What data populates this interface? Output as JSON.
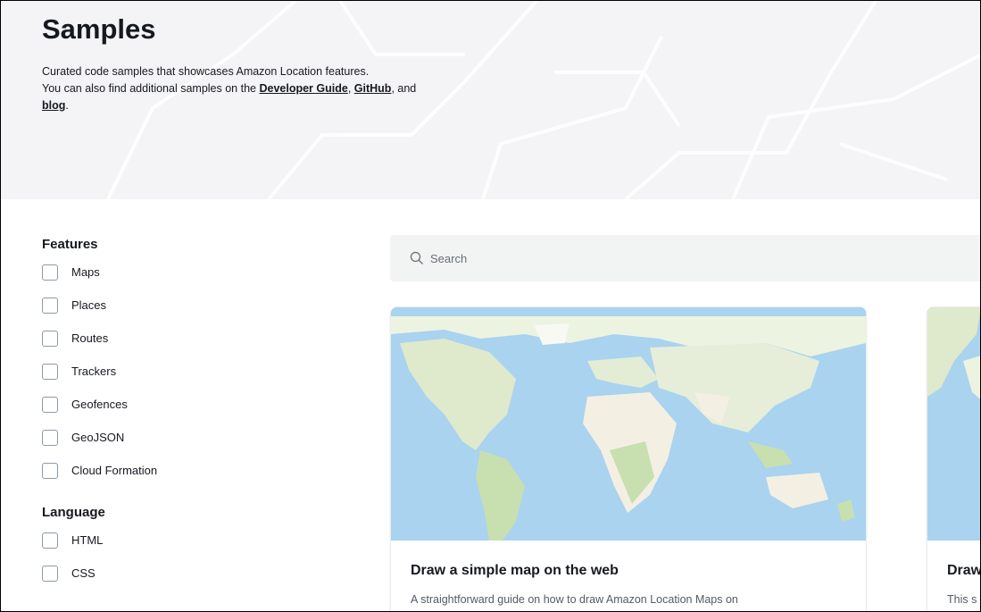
{
  "page": {
    "title": "Samples",
    "description_line1": "Curated code samples that showcases Amazon Location features.",
    "description_line2_prefix": "You can also find additional samples on the",
    "link_developer_guide": "Developer Guide",
    "sep1": ",",
    "link_github": "GitHub",
    "sep2": ", and",
    "link_blog": "blog",
    "end": "."
  },
  "filters": {
    "features_heading": "Features",
    "features": [
      "Maps",
      "Places",
      "Routes",
      "Trackers",
      "Geofences",
      "GeoJSON",
      "Cloud Formation"
    ],
    "language_heading": "Language",
    "languages": [
      "HTML",
      "CSS"
    ]
  },
  "search": {
    "placeholder": "Search",
    "icon": "search-icon"
  },
  "cards": [
    {
      "title": "Draw a simple map on the web",
      "text": "A straightforward guide on how to draw Amazon Location Maps on"
    },
    {
      "title": "Draw",
      "text": "This s"
    }
  ],
  "colors": {
    "ocean": "#a9d3ef",
    "land": "#ecf3e1",
    "forest": "#c8dfb0",
    "desert": "#f4efe3"
  }
}
